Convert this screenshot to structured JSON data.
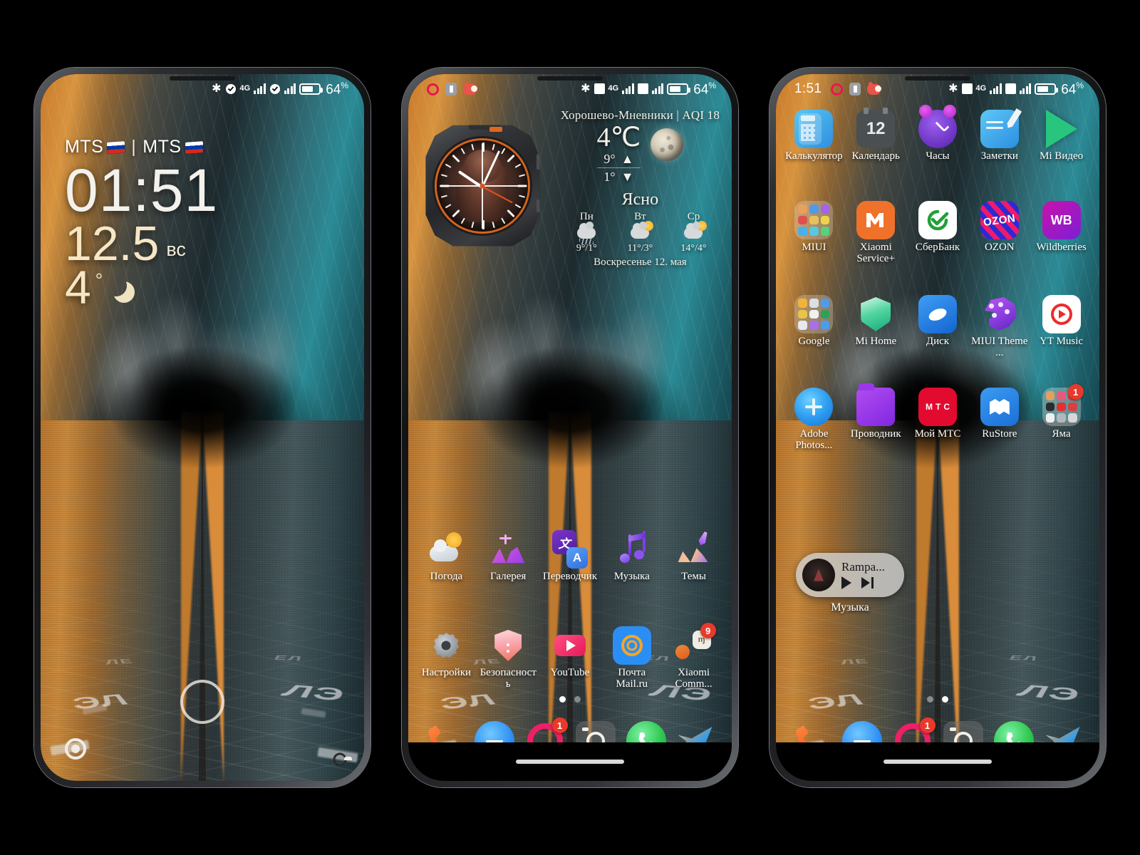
{
  "meta": {
    "device_count": 3,
    "accent_red": "#e8392b",
    "accent_orange": "#e0671f"
  },
  "phone1": {
    "name": "lockscreen",
    "statusbar": {
      "clock": "",
      "left_icons": [],
      "right_icons": [
        "bluetooth-icon",
        "vpn-icon",
        "4g-icon",
        "signal-bars-icon",
        "vpn-icon-2",
        "signal-bars-icon-2",
        "battery-icon"
      ],
      "network_label": "4G",
      "battery_percent": "64",
      "battery_unit": "%"
    },
    "carrier_1": "MTS",
    "carrier_separator": "|",
    "carrier_2": "MTS",
    "time": "01:51",
    "date": "12.5",
    "weekday": "вс",
    "temperature": "4",
    "degree": "°",
    "bottom_left_icon": "assistant-icon",
    "bottom_right_icon": "camera-icon",
    "unlock_ring": "unlock-ring"
  },
  "phone2": {
    "name": "homescreen-page-1",
    "statusbar": {
      "clock": "",
      "left_icons": [
        "opera-icon",
        "battery-saver-icon",
        "piggy-icon"
      ],
      "right_icons": [
        "bluetooth-icon",
        "sim-icon",
        "4g-icon",
        "signal-bars-icon",
        "sim-icon-2",
        "signal-bars-icon-2",
        "battery-icon"
      ],
      "network_label": "4G",
      "battery_percent": "64",
      "battery_unit": "%"
    },
    "clock_widget": {
      "name": "analog-watch-widget",
      "style": "rugged-smartwatch-face"
    },
    "weather_widget": {
      "location": "Хорошево-Мневники | AQI 18",
      "temperature": "4℃",
      "high": "9°",
      "high_arrow": "▲",
      "low": "1°",
      "low_arrow": "▼",
      "condition": "Ясно",
      "moon_icon": "moon-icon",
      "forecast": [
        {
          "day": "Пн",
          "icon": "rain-cloud-icon",
          "temps": "9°/1°"
        },
        {
          "day": "Вт",
          "icon": "partly-cloudy-icon",
          "temps": "11°/3°"
        },
        {
          "day": "Ср",
          "icon": "partly-cloudy-icon",
          "temps": "14°/4°"
        }
      ],
      "full_date": "Воскресенье 12. мая"
    },
    "apps": [
      {
        "label": "Погода",
        "icon": "weather-app-icon"
      },
      {
        "label": "Галерея",
        "icon": "gallery-app-icon"
      },
      {
        "label": "Переводчик",
        "icon": "translate-app-icon"
      },
      {
        "label": "Музыка",
        "icon": "music-app-icon"
      },
      {
        "label": "Темы",
        "icon": "themes-app-icon"
      },
      {
        "label": "Настройки",
        "icon": "settings-app-icon"
      },
      {
        "label": "Безопасность",
        "icon": "security-app-icon"
      },
      {
        "label": "YouTube",
        "icon": "youtube-app-icon"
      },
      {
        "label": "Почта Mail.ru",
        "icon": "mailru-app-icon"
      },
      {
        "label": "Xiaomi Comm...",
        "icon": "xiaomi-community-app-icon",
        "badge": "9"
      }
    ],
    "page_dots": {
      "count": 2,
      "active": 1
    },
    "dock": [
      {
        "icon": "phone-dialer-icon",
        "label": ""
      },
      {
        "icon": "messages-icon",
        "label": ""
      },
      {
        "icon": "instagram-icon",
        "label": "",
        "badge": "1"
      },
      {
        "icon": "camera-icon",
        "label": ""
      },
      {
        "icon": "whatsapp-icon",
        "label": ""
      },
      {
        "icon": "telegram-icon",
        "label": ""
      }
    ]
  },
  "phone3": {
    "name": "homescreen-page-2",
    "statusbar": {
      "clock": "1:51",
      "left_icons": [
        "opera-icon",
        "battery-saver-icon",
        "piggy-icon"
      ],
      "right_icons": [
        "bluetooth-icon",
        "sim-icon",
        "4g-icon",
        "signal-bars-icon",
        "sim-icon-2",
        "signal-bars-icon-2",
        "battery-icon"
      ],
      "network_label": "4G",
      "battery_percent": "64",
      "battery_unit": "%"
    },
    "apps": [
      {
        "label": "Калькулятор",
        "icon": "calculator-app-icon"
      },
      {
        "label": "Календарь",
        "icon": "calendar-app-icon",
        "day_number": "12"
      },
      {
        "label": "Часы",
        "icon": "clock-app-icon"
      },
      {
        "label": "Заметки",
        "icon": "notes-app-icon"
      },
      {
        "label": "Mi Видео",
        "icon": "mi-video-app-icon"
      },
      {
        "label": "MIUI",
        "icon": "miui-folder-icon"
      },
      {
        "label": "Xiaomi Service+",
        "icon": "xiaomi-service-app-icon"
      },
      {
        "label": "СберБанк",
        "icon": "sberbank-app-icon"
      },
      {
        "label": "OZON",
        "icon": "ozon-app-icon",
        "wordmark": "OZON"
      },
      {
        "label": "Wildberries",
        "icon": "wildberries-app-icon",
        "wordmark": "WB"
      },
      {
        "label": "Google",
        "icon": "google-folder-icon"
      },
      {
        "label": "Mi Home",
        "icon": "mi-home-app-icon"
      },
      {
        "label": "Диск",
        "icon": "yandex-disk-app-icon"
      },
      {
        "label": "MIUI Theme ...",
        "icon": "miui-theme-editor-app-icon"
      },
      {
        "label": "YT Music",
        "icon": "youtube-music-app-icon"
      },
      {
        "label": "Adobe Photos...",
        "icon": "adobe-photoshop-express-app-icon"
      },
      {
        "label": "Проводник",
        "icon": "file-manager-app-icon"
      },
      {
        "label": "Мой МТС",
        "icon": "my-mts-app-icon",
        "wordmark": "МТС"
      },
      {
        "label": "RuStore",
        "icon": "rustore-app-icon"
      },
      {
        "label": "Яма",
        "icon": "yama-folder-icon",
        "badge": "1"
      }
    ],
    "music_widget": {
      "title": "Rampa...",
      "label": "Музыка",
      "play_icon": "play-icon",
      "next_icon": "next-track-icon",
      "album_art": "album-art-thumbnail"
    },
    "page_dots": {
      "count": 2,
      "active": 2
    },
    "dock": [
      {
        "icon": "phone-dialer-icon",
        "label": ""
      },
      {
        "icon": "messages-icon",
        "label": ""
      },
      {
        "icon": "instagram-icon",
        "label": "",
        "badge": "1"
      },
      {
        "icon": "camera-icon",
        "label": ""
      },
      {
        "icon": "whatsapp-icon",
        "label": ""
      },
      {
        "icon": "telegram-icon",
        "label": ""
      }
    ]
  }
}
